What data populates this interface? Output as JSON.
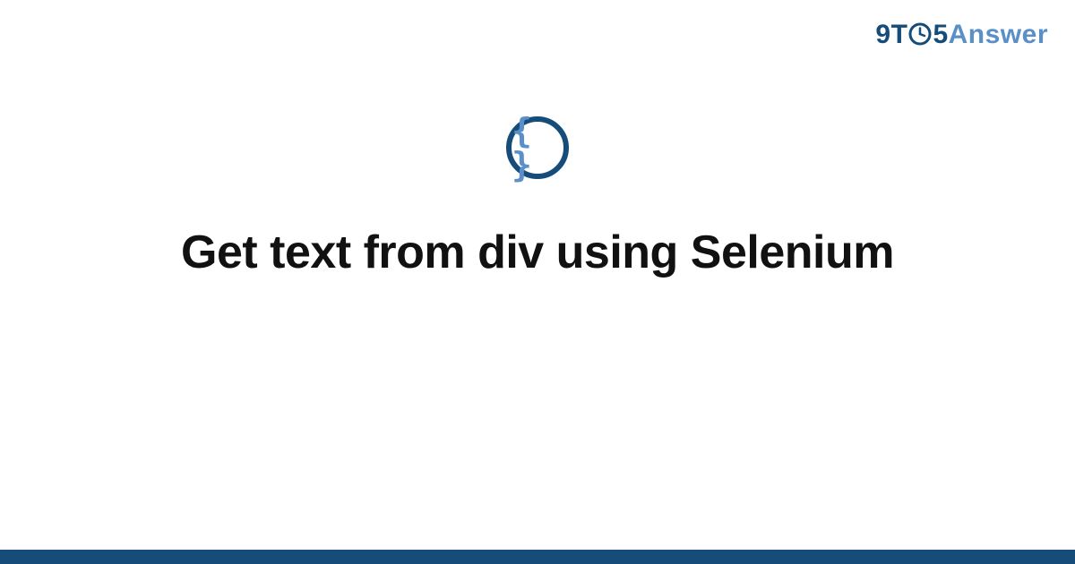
{
  "brand": {
    "prefix": "9T",
    "middle": "5",
    "suffix": "Answer"
  },
  "icon": {
    "glyph": "{ }",
    "name": "code-braces-icon"
  },
  "title": "Get text from div using Selenium",
  "colors": {
    "brand_dark": "#154c79",
    "brand_light": "#5a8fc7",
    "text": "#111111",
    "background": "#ffffff"
  }
}
